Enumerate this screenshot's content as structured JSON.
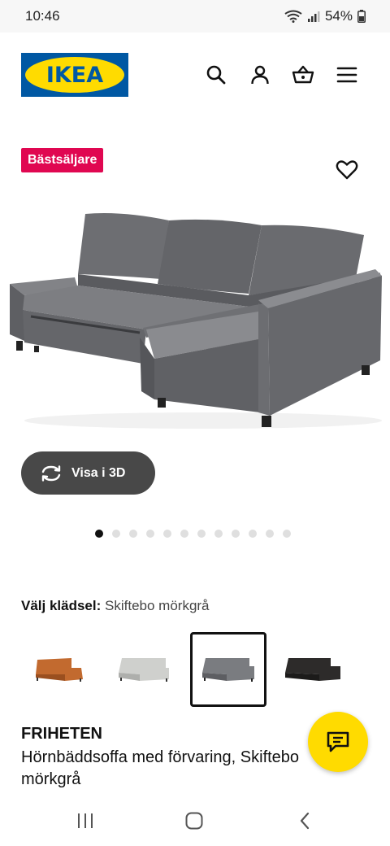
{
  "status_bar": {
    "time": "10:46",
    "battery": "54%"
  },
  "header": {
    "logo_text": "IKEA",
    "colors": {
      "brand_blue": "#0058a3",
      "brand_yellow": "#ffdb00"
    },
    "icons": [
      "search-icon",
      "account-icon",
      "basket-icon",
      "menu-icon"
    ]
  },
  "product": {
    "badge": "Bästsäljare",
    "badge_color": "#e00751",
    "view_3d_label": "Visa i 3D",
    "carousel": {
      "total": 12,
      "active_index": 0
    },
    "fabric_label": "Välj klädsel:",
    "fabric_value": "Skiftebo mörkgrå",
    "swatches": [
      {
        "color": "#c26a2f",
        "selected": false
      },
      {
        "color": "#cfd0cd",
        "selected": false
      },
      {
        "color": "#7a7c80",
        "selected": true
      },
      {
        "color": "#2d2b2a",
        "selected": false
      }
    ],
    "name": "FRIHETEN",
    "description": "Hörnbäddsoffa med förvaring, Skiftebo mörkgrå"
  }
}
